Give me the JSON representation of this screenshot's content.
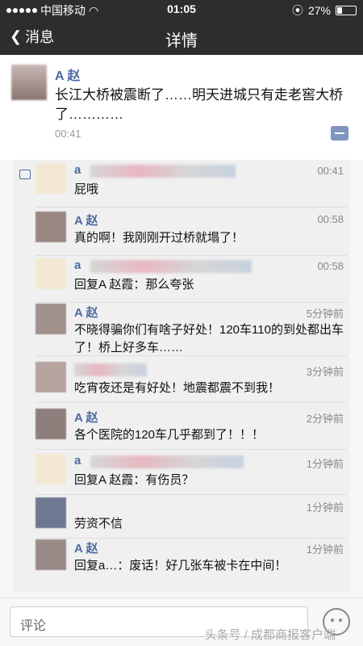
{
  "status": {
    "carrier": "中国移动",
    "time": "01:05",
    "battery": "27%"
  },
  "nav": {
    "back_label": "消息",
    "title": "详情"
  },
  "post": {
    "author": "A 赵",
    "text": "长江大桥被震断了……明天进城只有走老窖大桥了…………",
    "time": "00:41"
  },
  "comments": [
    {
      "name": "a",
      "text": "屁哦",
      "time": "00:41"
    },
    {
      "name": "A 赵",
      "text": "真的啊！我刚刚开过桥就塌了！",
      "time": "00:58"
    },
    {
      "name": "a",
      "text": "回复A 赵霞：那么夸张",
      "time": "00:58"
    },
    {
      "name": "A 赵",
      "text": "不晓得骗你们有啥子好处！120车110的到处都出车了！桥上好多车……",
      "time": "5分钟前"
    },
    {
      "name": "",
      "text": "吃宵夜还是有好处！地震都震不到我！",
      "time": "3分钟前"
    },
    {
      "name": "A 赵",
      "text": "各个医院的120车几乎都到了！！！",
      "time": "2分钟前"
    },
    {
      "name": "a",
      "text": "回复A 赵霞：有伤员？",
      "time": "1分钟前"
    },
    {
      "name": "",
      "text": "劳资不信",
      "time": "1分钟前"
    },
    {
      "name": "A 赵",
      "text": "回复a…：废话！好几张车被卡在中间！",
      "time": "1分钟前"
    }
  ],
  "footer": {
    "placeholder": "评论",
    "watermark": "头条号 / 成都商报客户端"
  }
}
